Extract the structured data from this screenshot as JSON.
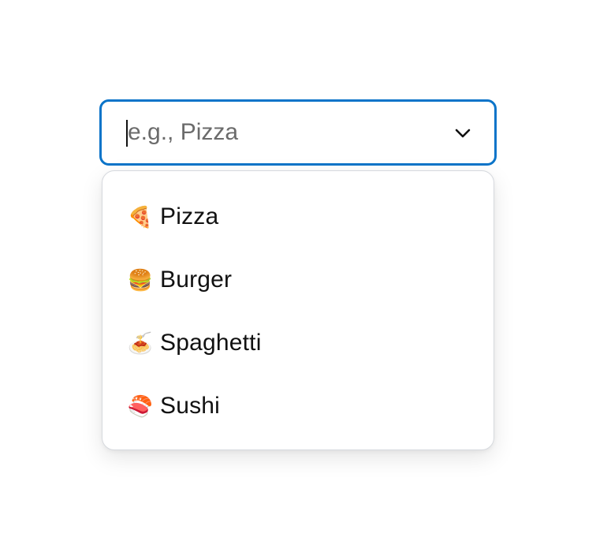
{
  "combobox": {
    "placeholder": "e.g., Pizza",
    "value": "",
    "accent_color": "#0b74c9",
    "toggle_icon": "chevron-down-icon"
  },
  "listbox": {
    "options": [
      {
        "icon": "pizza-icon",
        "glyph": "🍕",
        "label": "Pizza"
      },
      {
        "icon": "burger-icon",
        "glyph": "🍔",
        "label": "Burger"
      },
      {
        "icon": "spaghetti-icon",
        "glyph": "🍝",
        "label": "Spaghetti"
      },
      {
        "icon": "sushi-icon",
        "glyph": "🍣",
        "label": "Sushi"
      }
    ]
  }
}
